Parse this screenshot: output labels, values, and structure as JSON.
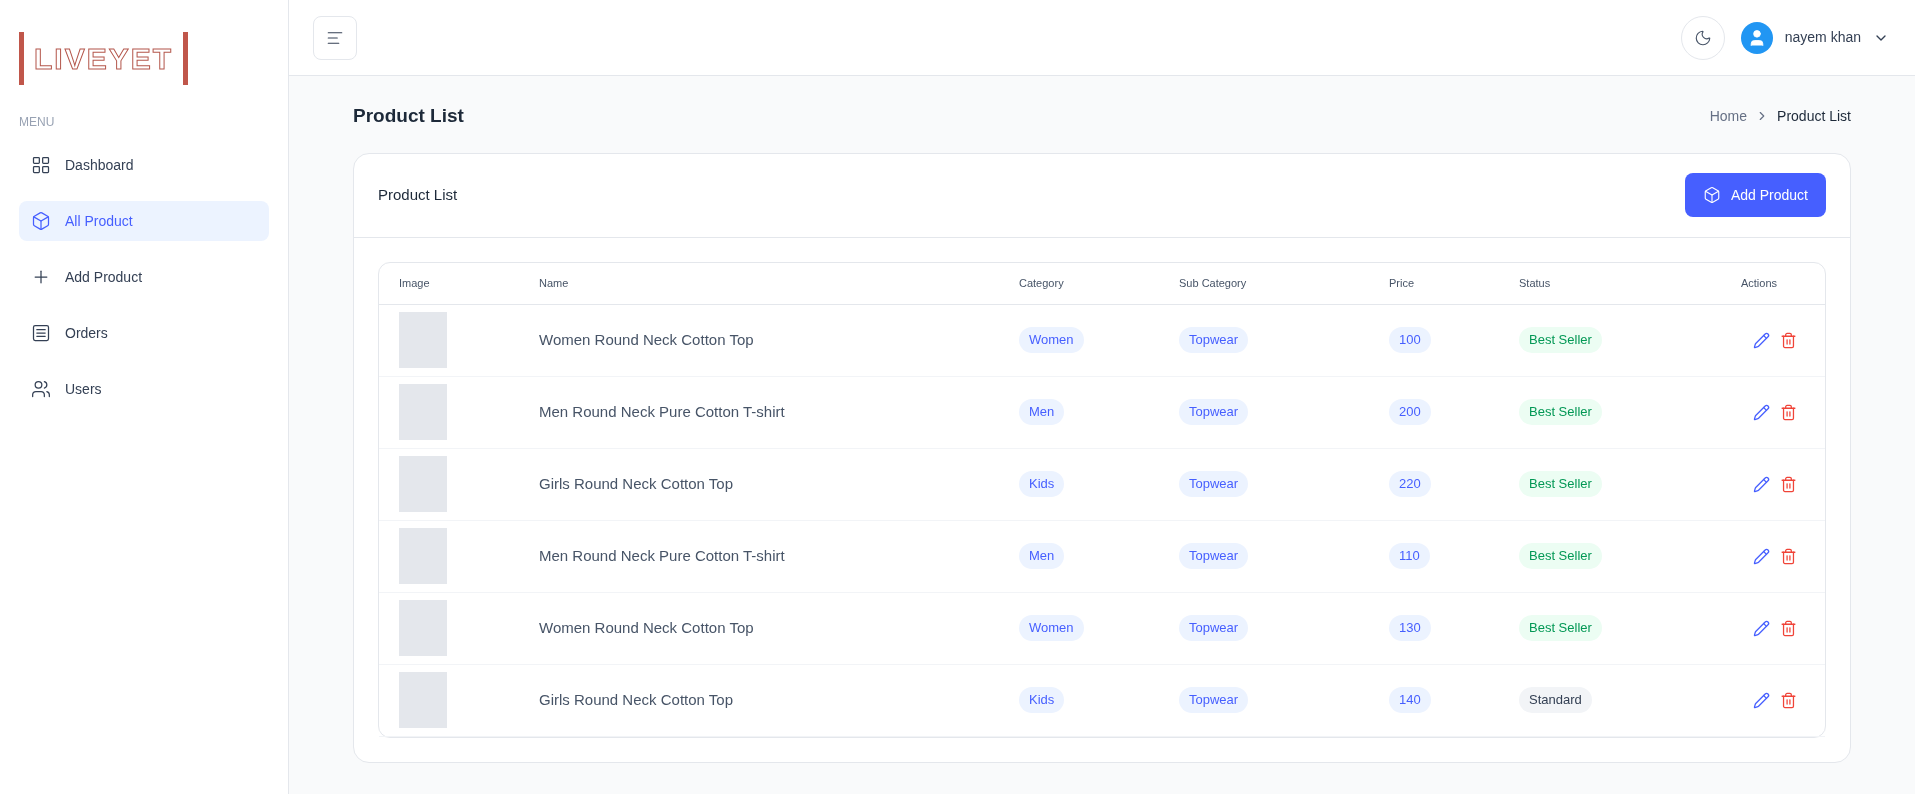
{
  "logo": {
    "text": "LIVEYET"
  },
  "sidebar": {
    "heading": "MENU",
    "items": [
      {
        "label": "Dashboard",
        "selected": false
      },
      {
        "label": "All Product",
        "selected": true
      },
      {
        "label": "Add Product",
        "selected": false
      },
      {
        "label": "Orders",
        "selected": false
      },
      {
        "label": "Users",
        "selected": false
      }
    ]
  },
  "header": {
    "user": "nayem khan"
  },
  "page": {
    "title": "Product List",
    "breadcrumb": [
      "Home",
      "Product List"
    ]
  },
  "card": {
    "title": "Product List",
    "button": "Add Product"
  },
  "table": {
    "columns": [
      "Image",
      "Name",
      "Category",
      "Sub Category",
      "Price",
      "Status",
      "Actions"
    ],
    "rows": [
      {
        "name": "Women Round Neck Cotton Top",
        "category": "Women",
        "sub_category": "Topwear",
        "price": "100",
        "status": {
          "text": "Best Seller",
          "kind": "best"
        }
      },
      {
        "name": "Men Round Neck Pure Cotton T-shirt",
        "category": "Men",
        "sub_category": "Topwear",
        "price": "200",
        "status": {
          "text": "Best Seller",
          "kind": "best"
        }
      },
      {
        "name": "Girls Round Neck Cotton Top",
        "category": "Kids",
        "sub_category": "Topwear",
        "price": "220",
        "status": {
          "text": "Best Seller",
          "kind": "best"
        }
      },
      {
        "name": "Men Round Neck Pure Cotton T-shirt",
        "category": "Men",
        "sub_category": "Topwear",
        "price": "110",
        "status": {
          "text": "Best Seller",
          "kind": "best"
        }
      },
      {
        "name": "Women Round Neck Cotton Top",
        "category": "Women",
        "sub_category": "Topwear",
        "price": "130",
        "status": {
          "text": "Best Seller",
          "kind": "best"
        }
      },
      {
        "name": "Girls Round Neck Cotton Top",
        "category": "Kids",
        "sub_category": "Topwear",
        "price": "140",
        "status": {
          "text": "Standard",
          "kind": "standard"
        }
      }
    ]
  }
}
